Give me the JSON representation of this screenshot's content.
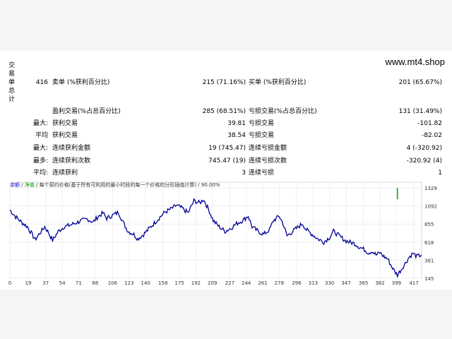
{
  "site": {
    "brand": "www.mt4.shop"
  },
  "section_label": "交易单总计",
  "summary": {
    "total": "416",
    "sell_label": "卖单 (%获利百分比)",
    "sell_value": "215 (71.16%)",
    "buy_label": "买单 (%获利百分比)",
    "buy_value": "201 (65.67%)"
  },
  "stats": [
    {
      "prefix": "",
      "l_label": "盈利交易(%占总百分比)",
      "l_value": "285 (68.51%)",
      "r_label": "亏损交易(%占总百分比)",
      "r_value": "131 (31.49%)"
    },
    {
      "prefix": "最大:",
      "l_label": "获利交易",
      "l_value": "39.81",
      "r_label": "亏损交易",
      "r_value": "-101.82"
    },
    {
      "prefix": "平均",
      "l_label": "获利交易",
      "l_value": "38.54",
      "r_label": "亏损交易",
      "r_value": "-82.02"
    },
    {
      "prefix": "最大:",
      "l_label": "连续获利金额",
      "l_value": "19 (745.47)",
      "r_label": "连续亏损金额",
      "r_value": "4 (-320.92)"
    },
    {
      "prefix": "最多:",
      "l_label": "连续获利次数",
      "l_value": "745.47 (19)",
      "r_label": "连续亏损次数",
      "r_value": "-320.92 (4)"
    },
    {
      "prefix": "平均:",
      "l_label": "连续获利",
      "l_value": "3",
      "r_label": "连续亏损",
      "r_value": "1"
    }
  ],
  "chart_legend": {
    "item1": "余额",
    "sep": " / ",
    "item2": "净值",
    "rest": " / 每个契约价格(基于所有可利用的最小时段的每一个价格的分形插值计算) / 90.00%"
  },
  "chart_data": {
    "type": "line",
    "series_color": "#000099",
    "x_ticks": [
      "0",
      "19",
      "37",
      "54",
      "71",
      "88",
      "106",
      "123",
      "140",
      "158",
      "175",
      "192",
      "209",
      "227",
      "244",
      "261",
      "278",
      "296",
      "313",
      "330",
      "347",
      "365",
      "382",
      "399",
      "417"
    ],
    "y_ticks": [
      "1329",
      "1092",
      "855",
      "618",
      "381",
      "145"
    ],
    "ylim": [
      145,
      1329
    ],
    "xlim": [
      0,
      425
    ],
    "anchors": [
      [
        0,
        1040
      ],
      [
        6,
        950
      ],
      [
        12,
        880
      ],
      [
        18,
        820
      ],
      [
        22,
        740
      ],
      [
        26,
        650
      ],
      [
        30,
        720
      ],
      [
        36,
        820
      ],
      [
        40,
        740
      ],
      [
        44,
        640
      ],
      [
        50,
        760
      ],
      [
        56,
        820
      ],
      [
        62,
        840
      ],
      [
        68,
        870
      ],
      [
        74,
        900
      ],
      [
        80,
        920
      ],
      [
        86,
        880
      ],
      [
        90,
        940
      ],
      [
        96,
        1000
      ],
      [
        100,
        930
      ],
      [
        106,
        970
      ],
      [
        112,
        1010
      ],
      [
        118,
        850
      ],
      [
        122,
        760
      ],
      [
        128,
        720
      ],
      [
        132,
        660
      ],
      [
        138,
        720
      ],
      [
        144,
        800
      ],
      [
        150,
        880
      ],
      [
        156,
        960
      ],
      [
        160,
        1010
      ],
      [
        166,
        1050
      ],
      [
        172,
        1100
      ],
      [
        178,
        1060
      ],
      [
        184,
        1000
      ],
      [
        190,
        1160
      ],
      [
        196,
        1130
      ],
      [
        200,
        1180
      ],
      [
        206,
        1020
      ],
      [
        210,
        900
      ],
      [
        216,
        820
      ],
      [
        222,
        760
      ],
      [
        228,
        800
      ],
      [
        234,
        860
      ],
      [
        240,
        900
      ],
      [
        246,
        960
      ],
      [
        250,
        820
      ],
      [
        256,
        760
      ],
      [
        262,
        720
      ],
      [
        268,
        780
      ],
      [
        272,
        900
      ],
      [
        278,
        960
      ],
      [
        282,
        860
      ],
      [
        286,
        700
      ],
      [
        290,
        740
      ],
      [
        296,
        800
      ],
      [
        302,
        860
      ],
      [
        306,
        780
      ],
      [
        312,
        720
      ],
      [
        318,
        660
      ],
      [
        324,
        620
      ],
      [
        330,
        680
      ],
      [
        334,
        760
      ],
      [
        340,
        700
      ],
      [
        346,
        640
      ],
      [
        350,
        620
      ],
      [
        356,
        600
      ],
      [
        360,
        560
      ],
      [
        366,
        520
      ],
      [
        370,
        480
      ],
      [
        374,
        500
      ],
      [
        378,
        450
      ],
      [
        382,
        480
      ],
      [
        386,
        430
      ],
      [
        390,
        400
      ],
      [
        394,
        300
      ],
      [
        398,
        220
      ],
      [
        400,
        190
      ],
      [
        404,
        260
      ],
      [
        408,
        340
      ],
      [
        412,
        420
      ],
      [
        416,
        470
      ],
      [
        420,
        430
      ],
      [
        425,
        450
      ]
    ]
  }
}
